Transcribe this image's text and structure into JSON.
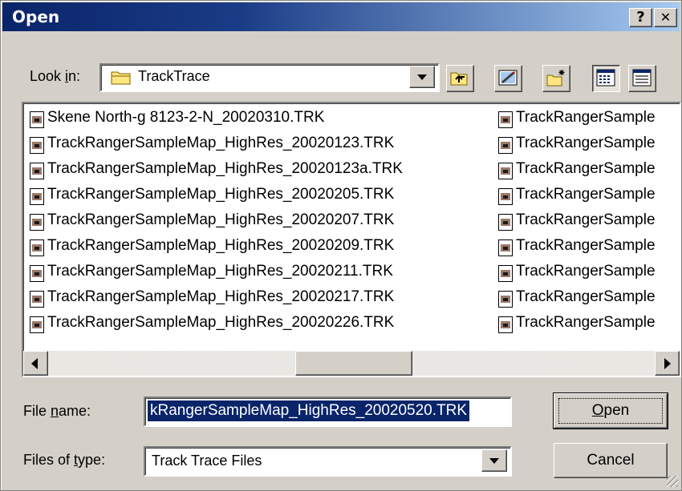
{
  "dialog": {
    "title": "Open",
    "help_label": "?",
    "close_label": "✕"
  },
  "lookin": {
    "label_pre": "Look ",
    "label_key": "i",
    "label_post": "n:",
    "value": "TrackTrace",
    "icon": "folder-icon"
  },
  "toolbar": {
    "icons": [
      "up-one-level-icon",
      "desktop-icon",
      "new-folder-icon",
      "list-view-icon",
      "details-view-icon"
    ]
  },
  "files": {
    "column1": [
      "Skene North-g 8123-2-N_20020310.TRK",
      "TrackRangerSampleMap_HighRes_20020123.TRK",
      "TrackRangerSampleMap_HighRes_20020123a.TRK",
      "TrackRangerSampleMap_HighRes_20020205.TRK",
      "TrackRangerSampleMap_HighRes_20020207.TRK",
      "TrackRangerSampleMap_HighRes_20020209.TRK",
      "TrackRangerSampleMap_HighRes_20020211.TRK",
      "TrackRangerSampleMap_HighRes_20020217.TRK",
      "TrackRangerSampleMap_HighRes_20020226.TRK"
    ],
    "column2": [
      "TrackRangerSample",
      "TrackRangerSample",
      "TrackRangerSample",
      "TrackRangerSample",
      "TrackRangerSample",
      "TrackRangerSample",
      "TrackRangerSample",
      "TrackRangerSample",
      "TrackRangerSample"
    ]
  },
  "filename": {
    "label_pre": "File ",
    "label_key": "n",
    "label_post": "ame:",
    "value": "kRangerSampleMap_HighRes_20020520.TRK"
  },
  "filetype": {
    "label_pre": "Files of ",
    "label_key": "t",
    "label_post": "ype:",
    "value": "Track Trace Files"
  },
  "buttons": {
    "open_key": "O",
    "open_rest": "pen",
    "cancel": "Cancel"
  },
  "colors": {
    "title_bar": "#0a246a",
    "selection": "#0a246a",
    "face": "#d4d0c8"
  }
}
